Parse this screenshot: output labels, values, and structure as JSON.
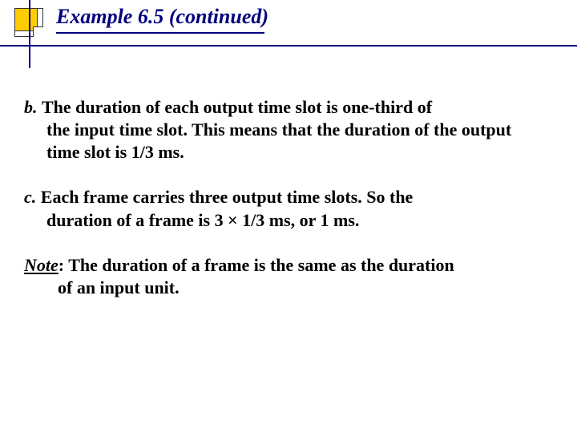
{
  "title": "Example 6.5 (continued)",
  "items": [
    {
      "marker": "b.  ",
      "line1": "The duration of each output time slot is one-third of",
      "rest": "the input time slot. This means that the duration of the output time slot is 1/3 ms."
    },
    {
      "marker": "c. ",
      "line1": "Each frame carries three output time slots. So the",
      "rest": "duration of a frame is 3 × 1/3 ms, or 1 ms."
    }
  ],
  "note": {
    "label": "Note",
    "line1": ": The duration of a frame is the same as the duration",
    "rest": "of an input unit."
  }
}
